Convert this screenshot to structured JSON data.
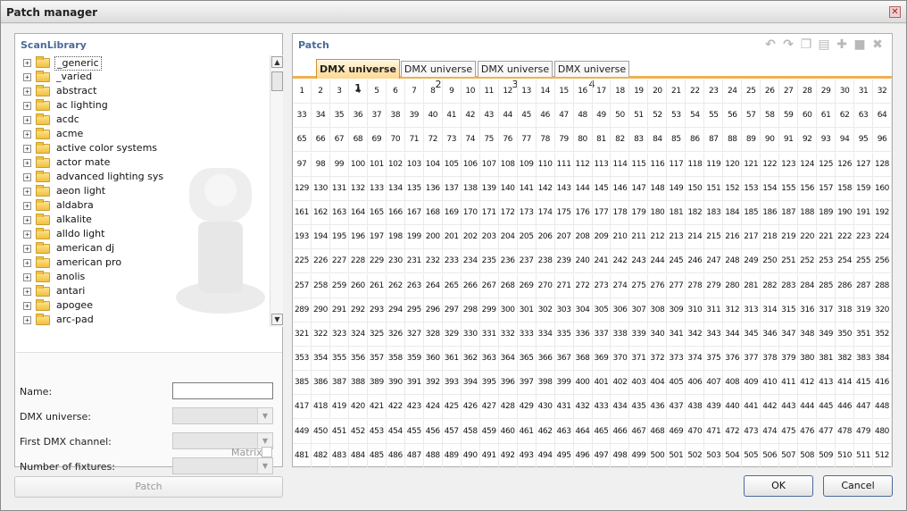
{
  "window": {
    "title": "Patch manager"
  },
  "library": {
    "title": "ScanLibrary",
    "items": [
      {
        "label": "_generic",
        "selected": true
      },
      {
        "label": "_varied"
      },
      {
        "label": "abstract"
      },
      {
        "label": "ac lighting"
      },
      {
        "label": "acdc"
      },
      {
        "label": "acme"
      },
      {
        "label": "active color systems"
      },
      {
        "label": "actor mate"
      },
      {
        "label": "advanced lighting sys"
      },
      {
        "label": "aeon light"
      },
      {
        "label": "aldabra"
      },
      {
        "label": "alkalite"
      },
      {
        "label": "alldo light"
      },
      {
        "label": "american dj"
      },
      {
        "label": "american pro"
      },
      {
        "label": "anolis"
      },
      {
        "label": "antari"
      },
      {
        "label": "apogee"
      },
      {
        "label": "arc-pad"
      }
    ]
  },
  "form": {
    "name_label": "Name:",
    "name_value": "",
    "universe_label": "DMX universe:",
    "channel_label": "First DMX channel:",
    "fixtures_label": "Number of fixtures:",
    "matrix_label": "Matrix"
  },
  "buttons": {
    "patch": "Patch",
    "ok": "OK",
    "cancel": "Cancel"
  },
  "patch": {
    "title": "Patch",
    "tabs": [
      "DMX universe 1",
      "DMX universe 2",
      "DMX universe 3",
      "DMX universe 4"
    ],
    "active_tab": 0,
    "channel_count": 512,
    "columns": 32
  }
}
